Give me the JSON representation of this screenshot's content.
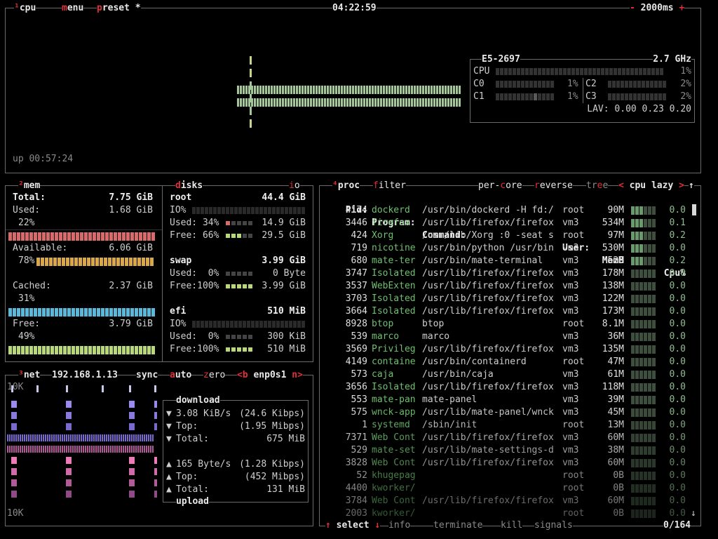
{
  "cpu": {
    "hotkey": "¹",
    "title": "cpu",
    "menu_m": "m",
    "menu_rest": "enu",
    "preset_p": "p",
    "preset_rest": "reset",
    "preset_star": "*",
    "clock": "04:22:59",
    "minus": "-",
    "interval": "2000ms",
    "plus": "+",
    "uptime": "up 00:57:24",
    "model": "E5-2697",
    "freq": "2.7 GHz",
    "total_label": "CPU",
    "total_pct": "1%",
    "cores": [
      {
        "label": "C0",
        "pct": "1%",
        "value": 0.01
      },
      {
        "label": "C1",
        "pct": "1%",
        "value": 0.01
      },
      {
        "label": "C2",
        "pct": "2%",
        "value": 0.02
      },
      {
        "label": "C3",
        "pct": "2%",
        "value": 0.02
      }
    ],
    "lav": "LAV: 0.00 0.23 0.20",
    "colors": {
      "graph": "#a4c899",
      "graph_dim": "#c8d48a"
    }
  },
  "mem": {
    "hotkey": "²",
    "title": "mem",
    "total_label": "Total:",
    "total_value": "7.75 GiB",
    "used_label": "Used:",
    "used_value": "1.68 GiB",
    "used_pct": "22%",
    "available_label": "Available:",
    "available_value": "6.06 GiB",
    "available_pct": "78%",
    "cached_label": "Cached:",
    "cached_value": "2.37 GiB",
    "cached_pct": "31%",
    "free_label": "Free:",
    "free_value": "3.79 GiB",
    "free_pct": "49%",
    "colors": {
      "used": "#d86a6a",
      "available": "#d8a84a",
      "cached": "#5ab8d8",
      "free": "#b8d87a"
    }
  },
  "disks": {
    "title_d": "d",
    "title_rest": "isks",
    "io_i": "i",
    "io_o": "o",
    "root": {
      "name": "root",
      "size": "44.4 GiB",
      "io": "IO%",
      "used_label": "Used: 34%",
      "used_value": "14.9 GiB",
      "free_label": "Free: 66%",
      "free_value": "29.5 GiB"
    },
    "swap": {
      "name": "swap",
      "size": "3.99 GiB",
      "used_label": "Used:  0%",
      "used_value": "0 Byte",
      "free_label": "Free:100%",
      "free_value": "3.99 GiB"
    },
    "efi": {
      "name": "efi",
      "size": "510 MiB",
      "io": "IO%",
      "used_label": "Used:  0%",
      "used_value": "300 KiB",
      "free_label": "Free:100%",
      "free_value": "510 MiB"
    }
  },
  "net": {
    "hotkey": "³",
    "title": "net",
    "ip": "192.168.1.13",
    "sync": "sync",
    "auto_a": "a",
    "auto_rest": "uto",
    "zero_z": "z",
    "zero_rest": "ero",
    "prev": "<b",
    "iface": "enp0s1",
    "next": "n>",
    "scale_top": "10K",
    "scale_bottom": "10K",
    "download_title": "download",
    "down_rate": "3.08 KiB/s",
    "down_bits": "(24.6 Kibps)",
    "down_top_label": "Top:",
    "down_top": "(1.95 Mibps)",
    "down_total_label": "Total:",
    "down_total": "675 MiB",
    "up_rate": "165 Byte/s",
    "up_bits": "(1.28 Kibps)",
    "up_top_label": "Top:",
    "up_top": "(452 Mibps)",
    "up_total_label": "Total:",
    "up_total": "131 MiB",
    "upload_title": "upload",
    "arrow_down": "▼",
    "arrow_up": "▲"
  },
  "proc": {
    "hotkey": "⁴",
    "title": "proc",
    "filter_f": "f",
    "filter_rest": "ilter",
    "percore_a": "per-",
    "percore_c": "c",
    "percore_b": "ore",
    "reverse_r": "r",
    "reverse_rest": "everse",
    "tree_a": "tr",
    "tree_e": "e",
    "tree_b": "e",
    "sort_prev": "<",
    "sort": "cpu lazy",
    "sort_next": ">",
    "scroll_up": "↑",
    "scroll_down": "↓",
    "headers": {
      "pid": "Pid:",
      "program": "Program:",
      "command": "Command:",
      "user": "User:",
      "mem": "MemB",
      "cpu": "Cpu%"
    },
    "rows": [
      {
        "pid": "4174",
        "program": "dockerd",
        "command": "/usr/bin/dockerd -H fd:/",
        "user": "root",
        "mem": "90M",
        "cpu": "0.0"
      },
      {
        "pid": "3446",
        "program": "firefox",
        "command": "/usr/lib/firefox/firefox",
        "user": "vm3",
        "mem": "534M",
        "cpu": "0.1"
      },
      {
        "pid": "424",
        "program": "Xorg",
        "command": "/usr/lib/Xorg :0 -seat s",
        "user": "root",
        "mem": "97M",
        "cpu": "0.2"
      },
      {
        "pid": "719",
        "program": "nicotine",
        "command": "/usr/bin/python /usr/bin",
        "user": "vm3",
        "mem": "530M",
        "cpu": "0.0"
      },
      {
        "pid": "680",
        "program": "mate-ter",
        "command": "/usr/bin/mate-terminal",
        "user": "vm3",
        "mem": "52M",
        "cpu": "0.2"
      },
      {
        "pid": "3747",
        "program": "Isolated",
        "command": "/usr/lib/firefox/firefox",
        "user": "vm3",
        "mem": "178M",
        "cpu": "0.0"
      },
      {
        "pid": "3537",
        "program": "WebExten",
        "command": "/usr/lib/firefox/firefox",
        "user": "vm3",
        "mem": "138M",
        "cpu": "0.0"
      },
      {
        "pid": "3703",
        "program": "Isolated",
        "command": "/usr/lib/firefox/firefox",
        "user": "vm3",
        "mem": "122M",
        "cpu": "0.0"
      },
      {
        "pid": "3664",
        "program": "Isolated",
        "command": "/usr/lib/firefox/firefox",
        "user": "vm3",
        "mem": "173M",
        "cpu": "0.0"
      },
      {
        "pid": "8928",
        "program": "btop",
        "command": "btop",
        "user": "root",
        "mem": "8.1M",
        "cpu": "0.0"
      },
      {
        "pid": "539",
        "program": "marco",
        "command": "marco",
        "user": "vm3",
        "mem": "36M",
        "cpu": "0.0"
      },
      {
        "pid": "3569",
        "program": "Privileg",
        "command": "/usr/lib/firefox/firefox",
        "user": "vm3",
        "mem": "135M",
        "cpu": "0.0"
      },
      {
        "pid": "4149",
        "program": "containe",
        "command": "/usr/bin/containerd",
        "user": "root",
        "mem": "47M",
        "cpu": "0.0"
      },
      {
        "pid": "573",
        "program": "caja",
        "command": "/usr/bin/caja",
        "user": "vm3",
        "mem": "61M",
        "cpu": "0.0"
      },
      {
        "pid": "3656",
        "program": "Isolated",
        "command": "/usr/lib/firefox/firefox",
        "user": "vm3",
        "mem": "118M",
        "cpu": "0.0"
      },
      {
        "pid": "553",
        "program": "mate-pan",
        "command": "mate-panel",
        "user": "vm3",
        "mem": "39M",
        "cpu": "0.0"
      },
      {
        "pid": "575",
        "program": "wnck-app",
        "command": "/usr/lib/mate-panel/wnck",
        "user": "vm3",
        "mem": "45M",
        "cpu": "0.0"
      },
      {
        "pid": "1",
        "program": "systemd",
        "command": "/sbin/init",
        "user": "root",
        "mem": "13M",
        "cpu": "0.0"
      },
      {
        "pid": "7371",
        "program": "Web Cont",
        "command": "/usr/lib/firefox/firefox",
        "user": "vm3",
        "mem": "60M",
        "cpu": "0.0"
      },
      {
        "pid": "529",
        "program": "mate-set",
        "command": "/usr/lib/mate-settings-d",
        "user": "vm3",
        "mem": "38M",
        "cpu": "0.0"
      },
      {
        "pid": "3828",
        "program": "Web Cont",
        "command": "/usr/lib/firefox/firefox",
        "user": "vm3",
        "mem": "60M",
        "cpu": "0.0"
      },
      {
        "pid": "52",
        "program": "khugepag",
        "command": "",
        "user": "root",
        "mem": "0B",
        "cpu": "0.0"
      },
      {
        "pid": "4400",
        "program": "kworker/",
        "command": "",
        "user": "root",
        "mem": "0B",
        "cpu": "0.0"
      },
      {
        "pid": "3784",
        "program": "Web Cont",
        "command": "/usr/lib/firefox/firefox",
        "user": "vm3",
        "mem": "60M",
        "cpu": "0.0"
      },
      {
        "pid": "2003",
        "program": "kworker/",
        "command": "",
        "user": "root",
        "mem": "0B",
        "cpu": "0.0"
      }
    ],
    "footer": {
      "up_arrow": "↑",
      "select": "select",
      "down_arrow": "↓",
      "info_i": "i",
      "info_rest": "nfo",
      "terminate_t": "t",
      "terminate_rest": "erminate",
      "kill_k": "k",
      "kill_rest": "ill",
      "signals_s": "s",
      "signals_rest": "ignals",
      "count": "0/164"
    }
  }
}
